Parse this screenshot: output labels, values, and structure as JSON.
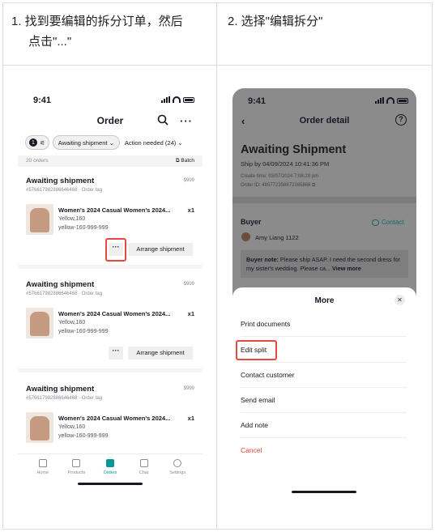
{
  "step1": {
    "title_line1": "1. 找到要编辑的拆分订单，然后",
    "title_line2": "点击\"...\""
  },
  "step2": {
    "title": "2. 选择\"编辑拆分\""
  },
  "phone1": {
    "time": "9:41",
    "title": "Order",
    "more_label": "···",
    "filters": {
      "count": "1",
      "status": "Awaiting shipment",
      "action": "Action needed (24)"
    },
    "order_count": "20 orders",
    "batch": "Batch",
    "orders": [
      {
        "status": "Awaiting shipment",
        "price": "$999",
        "id": "#576617982886646468 · Order tag",
        "product": "Women's 2024 Casual Women's 2024...",
        "qty": "x1",
        "variant": "Yellow,160",
        "sku": "yellow-160-999-999",
        "dots": "···",
        "arrange": "Arrange shipment"
      },
      {
        "status": "Awaiting shipment",
        "price": "$999",
        "id": "#576617982886646468 · Order tag",
        "product": "Women's 2024 Casual Women's 2024...",
        "qty": "x1",
        "variant": "Yellow,160",
        "sku": "yellow-160-999-999",
        "dots": "···",
        "arrange": "Arrange shipment"
      },
      {
        "status": "Awaiting shipment",
        "price": "$999",
        "id": "#576617982886646468 · Order tag",
        "product": "Women's 2024 Casual Women's 2024...",
        "qty": "x1",
        "variant": "Yellow,160",
        "sku": "yellow-160-999-999"
      }
    ],
    "tabs": [
      "Home",
      "Products",
      "Orders",
      "Chat",
      "Settings"
    ]
  },
  "phone2": {
    "time": "9:41",
    "title": "Order detail",
    "back": "‹",
    "help": "?",
    "status": "Awaiting Shipment",
    "ship_by": "Ship by 04/09/2024 10:41:36 PM",
    "create_time": "Create time: 03/07/2024 7:08:29 pm",
    "order_id": "Order ID: 485772358872365866",
    "buyer_label": "Buyer",
    "contact": "Contact",
    "buyer_name": "Amy Liang 1122",
    "note_label": "Buyer note:",
    "note_text": " Please ship ASAP. I need the second dress for my sister's wedding. Please ca...",
    "view_more": " View more",
    "sheet": {
      "title": "More",
      "close": "✕",
      "items": [
        "Print documents",
        "Edit split",
        "Contact customer",
        "Send email",
        "Add note",
        "Cancel"
      ]
    }
  },
  "colors": {
    "accent": "#009995",
    "highlight": "#e8493f",
    "cancel": "#e2473b"
  }
}
